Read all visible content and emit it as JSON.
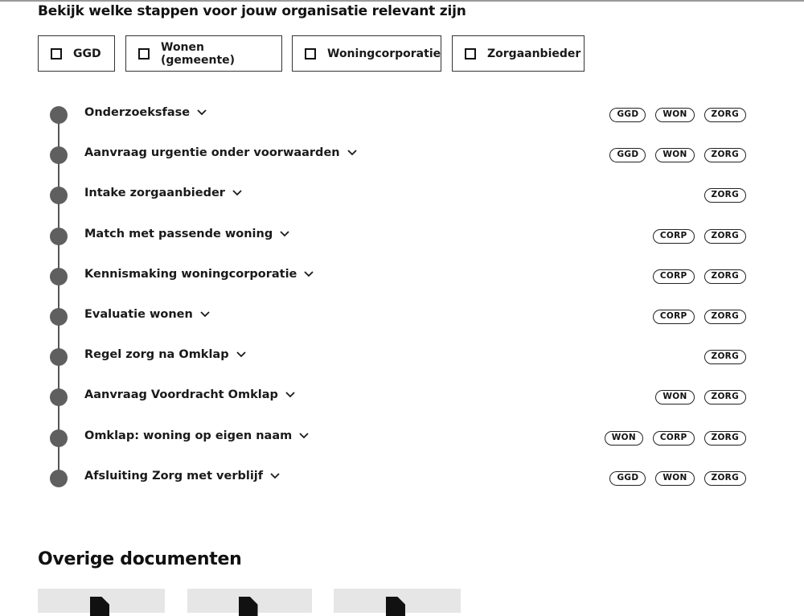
{
  "filters": {
    "heading": "Bekijk welke stappen voor jouw organisatie relevant zijn",
    "options": [
      {
        "label": "GGD",
        "checked": false
      },
      {
        "label": "Wonen (gemeente)",
        "checked": false
      },
      {
        "label": "Woningcorporatie",
        "checked": false
      },
      {
        "label": "Zorgaanbieder",
        "checked": false
      }
    ]
  },
  "steps": [
    {
      "title": "Onderzoeksfase",
      "tags": [
        "GGD",
        "WON",
        "ZORG"
      ]
    },
    {
      "title": "Aanvraag urgentie onder voorwaarden",
      "tags": [
        "GGD",
        "WON",
        "ZORG"
      ]
    },
    {
      "title": "Intake zorgaanbieder",
      "tags": [
        "ZORG"
      ]
    },
    {
      "title": "Match met passende woning",
      "tags": [
        "CORP",
        "ZORG"
      ]
    },
    {
      "title": "Kennismaking woningcorporatie",
      "tags": [
        "CORP",
        "ZORG"
      ]
    },
    {
      "title": "Evaluatie wonen",
      "tags": [
        "CORP",
        "ZORG"
      ]
    },
    {
      "title": "Regel zorg na Omklap",
      "tags": [
        "ZORG"
      ]
    },
    {
      "title": "Aanvraag Voordracht Omklap",
      "tags": [
        "WON",
        "ZORG"
      ]
    },
    {
      "title": "Omklap: woning op eigen naam",
      "tags": [
        "WON",
        "CORP",
        "ZORG"
      ]
    },
    {
      "title": "Afsluiting Zorg met verblijf",
      "tags": [
        "GGD",
        "WON",
        "ZORG"
      ]
    }
  ],
  "documents": {
    "heading": "Overige documenten",
    "card_icon": "document-icon"
  },
  "colors": {
    "timeline_dot": "#5f5f5f",
    "border": "#333333",
    "text": "#1a1a1a"
  }
}
